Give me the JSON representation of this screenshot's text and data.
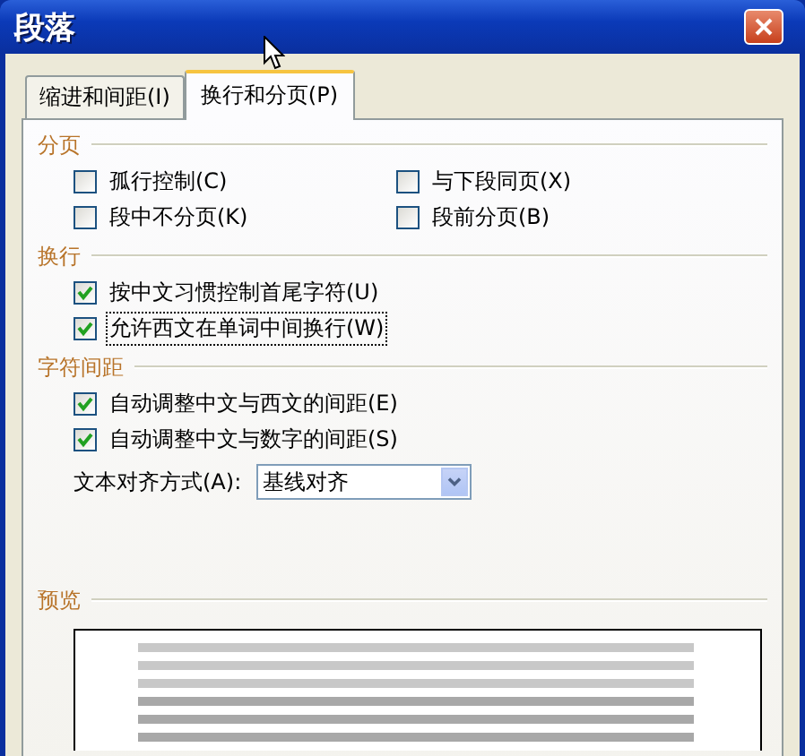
{
  "window": {
    "title": "段落"
  },
  "tabs": [
    {
      "label": "缩进和间距(I)",
      "selected": false
    },
    {
      "label": "换行和分页(P)",
      "selected": true
    }
  ],
  "groups": [
    {
      "title": "分页",
      "kind": "columns",
      "options": [
        {
          "kind": "checkbox",
          "label": "孤行控制(C)",
          "checked": false,
          "focused": false
        },
        {
          "kind": "checkbox",
          "label": "与下段同页(X)",
          "checked": false,
          "focused": false
        },
        {
          "kind": "checkbox",
          "label": "段中不分页(K)",
          "checked": false,
          "focused": false
        },
        {
          "kind": "checkbox",
          "label": "段前分页(B)",
          "checked": false,
          "focused": false
        }
      ]
    },
    {
      "title": "换行",
      "kind": "rows",
      "options": [
        {
          "kind": "checkbox",
          "label": "按中文习惯控制首尾字符(U)",
          "checked": true,
          "focused": false
        },
        {
          "kind": "checkbox",
          "label": "允许西文在单词中间换行(W)",
          "checked": true,
          "focused": true
        }
      ]
    },
    {
      "title": "字符间距",
      "kind": "rows",
      "options": [
        {
          "kind": "checkbox",
          "label": "自动调整中文与西文的间距(E)",
          "checked": true,
          "focused": false
        },
        {
          "kind": "checkbox",
          "label": "自动调整中文与数字的间距(S)",
          "checked": true,
          "focused": false
        },
        {
          "kind": "select",
          "label": "文本对齐方式(A):",
          "value": "基线对齐"
        }
      ]
    }
  ],
  "preview": {
    "title": "预览"
  }
}
